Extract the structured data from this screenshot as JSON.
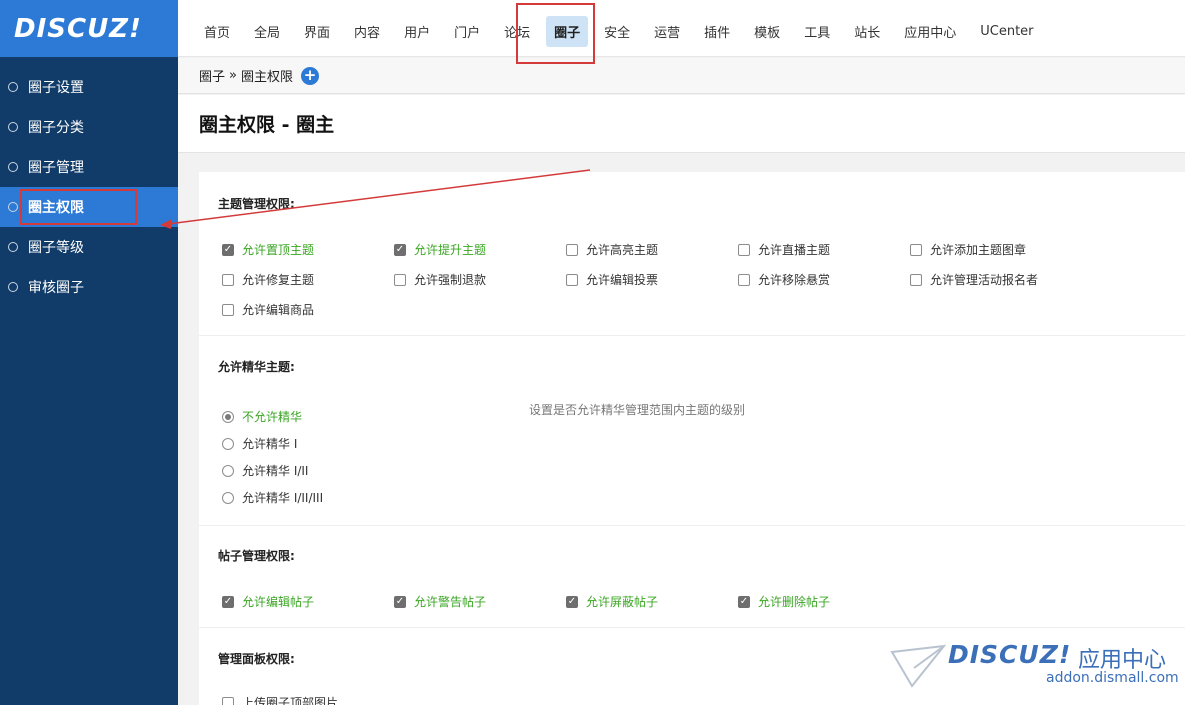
{
  "logo": "DISCUZ!",
  "sidebar": {
    "items": [
      {
        "label": "圈子设置"
      },
      {
        "label": "圈子分类"
      },
      {
        "label": "圈子管理"
      },
      {
        "label": "圈主权限"
      },
      {
        "label": "圈子等级"
      },
      {
        "label": "审核圈子"
      }
    ],
    "active_index": 3
  },
  "topnav": {
    "items": [
      "首页",
      "全局",
      "界面",
      "内容",
      "用户",
      "门户",
      "论坛",
      "圈子",
      "安全",
      "运营",
      "插件",
      "模板",
      "工具",
      "站长",
      "应用中心",
      "UCenter"
    ],
    "active": "圈子"
  },
  "breadcrumb": {
    "parent": "圈子",
    "sep": "»",
    "current": "圈主权限"
  },
  "page_title": "圈主权限 - 圈主",
  "sections": {
    "thread_manage": {
      "title": "主题管理权限:",
      "options": [
        {
          "label": "允许置顶主题",
          "checked": true
        },
        {
          "label": "允许提升主题",
          "checked": true
        },
        {
          "label": "允许高亮主题",
          "checked": false
        },
        {
          "label": "允许直播主题",
          "checked": false
        },
        {
          "label": "允许添加主题图章",
          "checked": false
        },
        {
          "label": "允许修复主题",
          "checked": false
        },
        {
          "label": "允许强制退款",
          "checked": false
        },
        {
          "label": "允许编辑投票",
          "checked": false
        },
        {
          "label": "允许移除悬赏",
          "checked": false
        },
        {
          "label": "允许管理活动报名者",
          "checked": false
        },
        {
          "label": "允许编辑商品",
          "checked": false
        }
      ]
    },
    "digest": {
      "title": "允许精华主题:",
      "hint": "设置是否允许精华管理范围内主题的级别",
      "options": [
        {
          "label": "不允许精华",
          "checked": true
        },
        {
          "label": "允许精华 I",
          "checked": false
        },
        {
          "label": "允许精华 I/II",
          "checked": false
        },
        {
          "label": "允许精华 I/II/III",
          "checked": false
        }
      ]
    },
    "post_manage": {
      "title": "帖子管理权限:",
      "options": [
        {
          "label": "允许编辑帖子",
          "checked": true
        },
        {
          "label": "允许警告帖子",
          "checked": true
        },
        {
          "label": "允许屏蔽帖子",
          "checked": true
        },
        {
          "label": "允许删除帖子",
          "checked": true
        }
      ]
    },
    "panel_manage": {
      "title": "管理面板权限:",
      "options": [
        {
          "label": "上传圈子顶部图片",
          "checked": false
        }
      ]
    }
  },
  "watermark": {
    "brand": "DISCUZ!",
    "cn": "应用中心",
    "url": "addon.dismall.com"
  },
  "colors": {
    "sidebar": "#113c69",
    "accent": "#2d7ad6",
    "checked_text": "#3aa623",
    "annotation": "#d43a3a"
  }
}
